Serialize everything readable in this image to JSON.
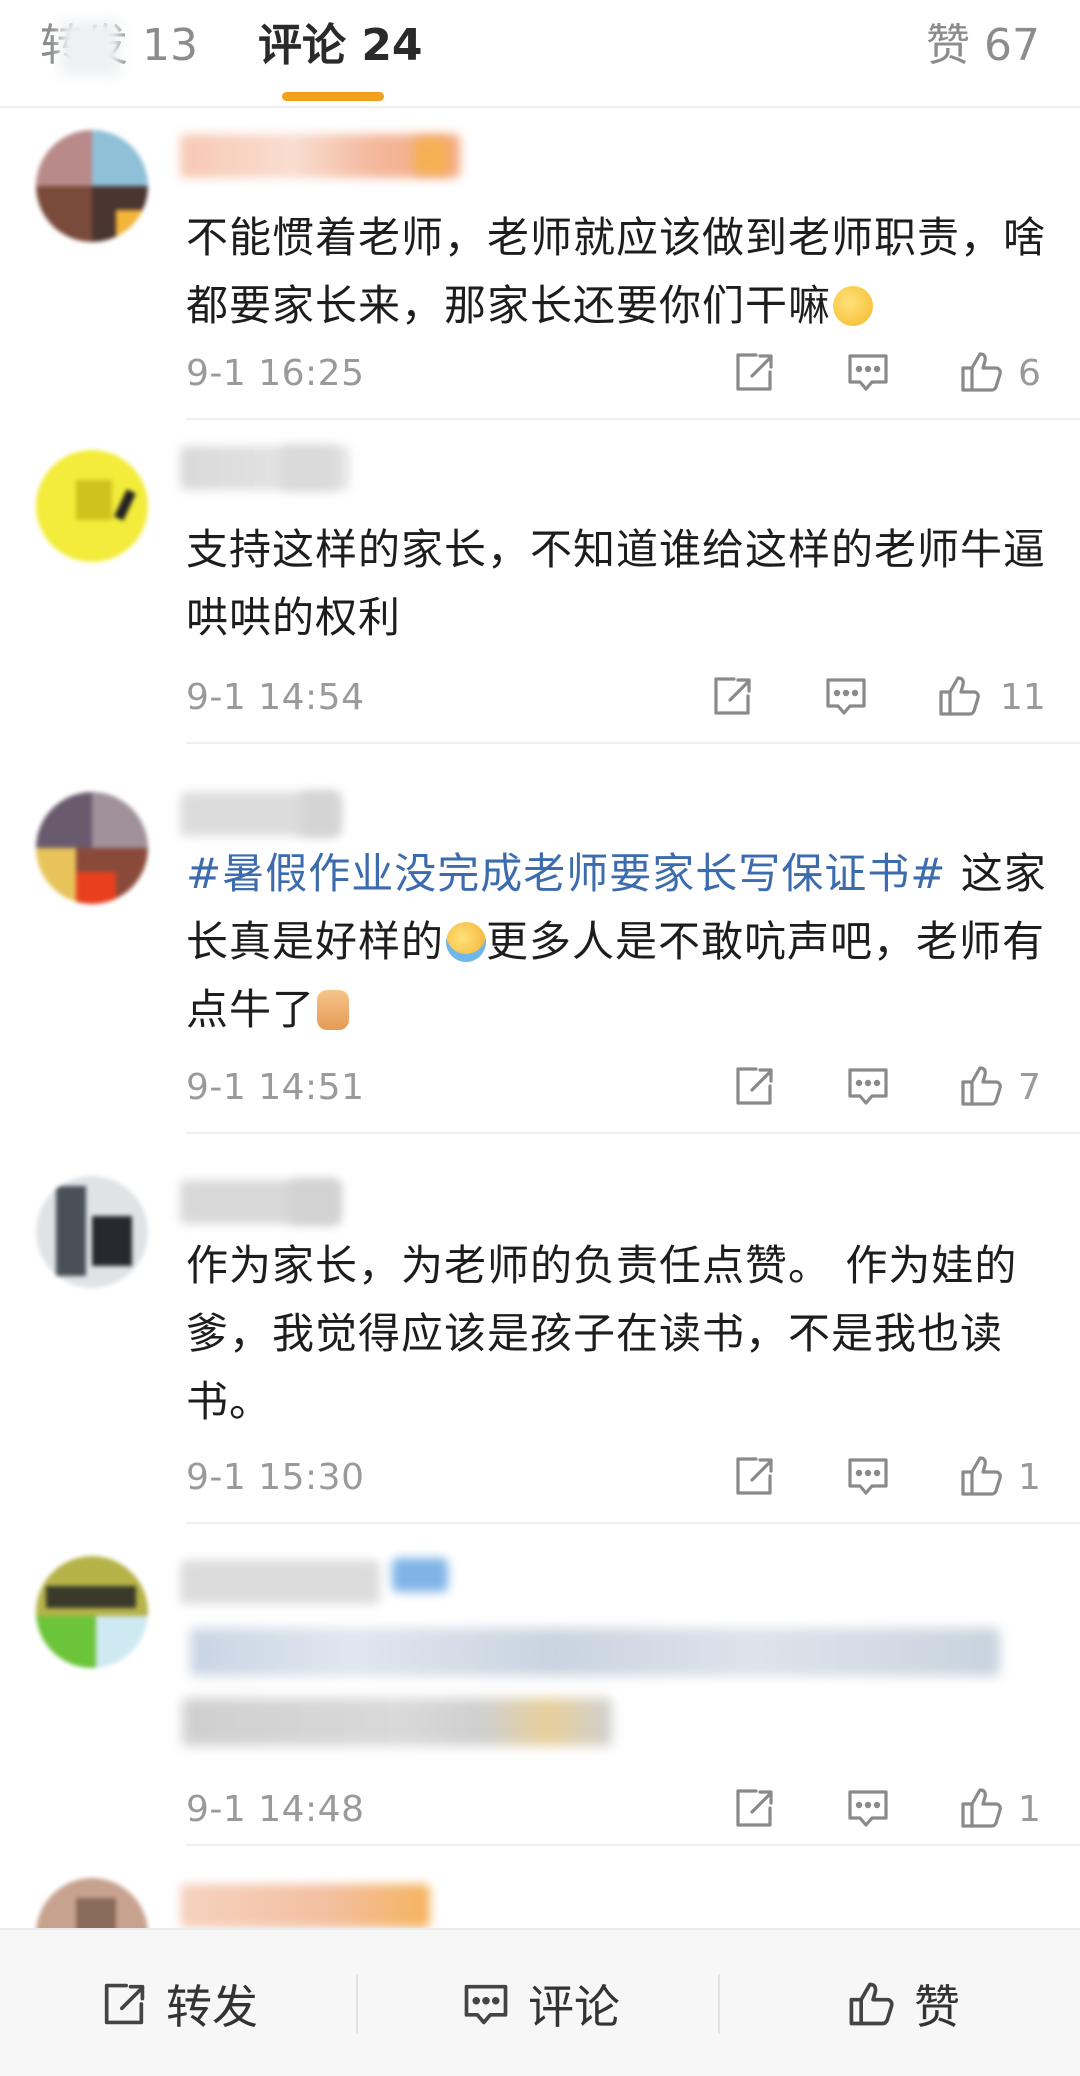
{
  "tabs": {
    "repost": "转发 13",
    "comment": "评论 24",
    "like": "赞 67"
  },
  "comments": [
    {
      "text": "不能惯着老师，老师就应该做到老师职责，啥都要家长来，那家长还要你们干嘛",
      "emoji": "smile-emoji",
      "time": "9-1 16:25",
      "likes": "6"
    },
    {
      "text": "支持这样的家长，不知道谁给这样的老师牛逼哄哄的权利",
      "time": "9-1 14:54",
      "likes": "11"
    },
    {
      "hashtag": "#暑假作业没完成老师要家长写保证书#",
      "text_a": " 这家长真是好样的",
      "text_b": "更多人是不敢吭声吧，老师有点牛了",
      "time": "9-1 14:51",
      "likes": "7"
    },
    {
      "text": "作为家长，为老师的负责任点赞。 作为娃的爹，我觉得应该是孩子在读书，不是我也读书。",
      "time": "9-1 15:30",
      "likes": "1"
    },
    {
      "time": "9-1 14:48",
      "likes": "1"
    }
  ],
  "bottom_bar": {
    "repost": "转发",
    "comment": "评论",
    "like": "赞"
  },
  "colors": {
    "tab_indicator": "#f0a01c",
    "hashtag": "#3c6cad",
    "meta_gray": "#9a9a9a"
  }
}
